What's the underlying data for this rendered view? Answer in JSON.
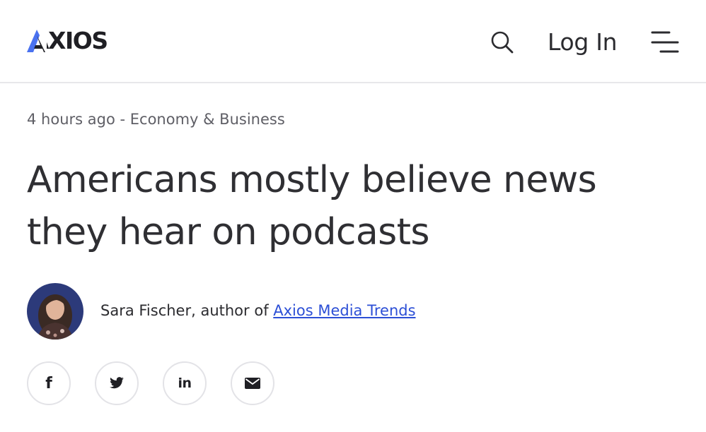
{
  "header": {
    "logo_text": "AXIOS",
    "login_label": "Log In",
    "icons": {
      "search": "search-icon",
      "menu": "menu-icon"
    },
    "brand_color": "#4a72f0"
  },
  "article": {
    "time_ago": "4 hours ago",
    "separator": " - ",
    "category": "Economy & Business",
    "headline": "Americans mostly believe news they hear on podcasts",
    "author": {
      "name_prefix": "Sara Fischer, author of ",
      "newsletter_link": "Axios Media Trends"
    }
  },
  "share": {
    "facebook_glyph": "f",
    "linkedin_glyph": "in",
    "icons": [
      "facebook-icon",
      "twitter-icon",
      "linkedin-icon",
      "email-icon"
    ]
  },
  "colors": {
    "link": "#2c4fd6",
    "text": "#2b2b2f",
    "meta": "#5f5f66"
  }
}
